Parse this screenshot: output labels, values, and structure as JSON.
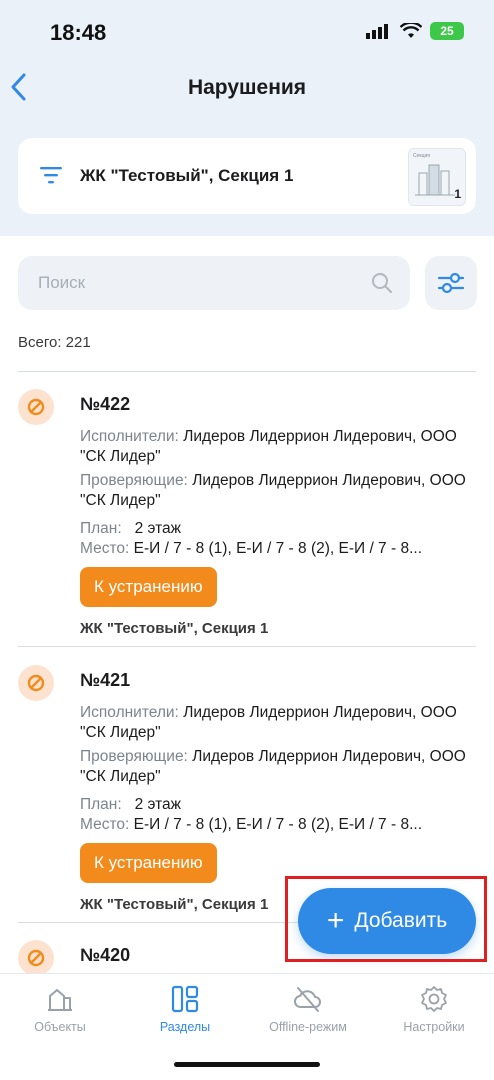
{
  "status_bar": {
    "time": "18:48",
    "battery": "25"
  },
  "nav": {
    "title": "Нарушения"
  },
  "project_selector": {
    "name": "ЖК \"Тестовый\", Секция 1",
    "thumb_label": "Секция",
    "thumb_number": "1"
  },
  "search": {
    "placeholder": "Поиск"
  },
  "total": "Всего: 221",
  "items": [
    {
      "number": "№422",
      "executors_label": "Исполнители:",
      "executors": "Лидеров Лидеррион Лидерович, ООО \"СК Лидер\"",
      "inspectors_label": "Проверяющие:",
      "inspectors": "Лидеров Лидеррион Лидерович, ООО \"СК Лидер\"",
      "plan_label": "План:",
      "plan": "2 этаж",
      "place_label": "Место:",
      "place": "Е-И / 7 - 8 (1), Е-И / 7 - 8 (2), Е-И / 7 - 8...",
      "status": "К устранению",
      "project": "ЖК \"Тестовый\", Секция 1"
    },
    {
      "number": "№421",
      "executors_label": "Исполнители:",
      "executors": "Лидеров Лидеррион Лидерович, ООО \"СК Лидер\"",
      "inspectors_label": "Проверяющие:",
      "inspectors": "Лидеров Лидеррион Лидерович, ООО \"СК Лидер\"",
      "plan_label": "План:",
      "plan": "2 этаж",
      "place_label": "Место:",
      "place": "Е-И / 7 - 8 (1), Е-И / 7 - 8 (2), Е-И / 7 - 8...",
      "status": "К устранению",
      "project": "ЖК \"Тестовый\", Секция 1"
    },
    {
      "number": "№420"
    }
  ],
  "fab": {
    "label": "Добавить"
  },
  "tabs": [
    {
      "label": "Объекты"
    },
    {
      "label": "Разделы",
      "active": true
    },
    {
      "label": "Offline-режим"
    },
    {
      "label": "Настройки"
    }
  ],
  "colors": {
    "accent": "#2f8ae6",
    "status": "#f28b1c",
    "badge_bg": "#fde3cf",
    "highlight": "#e02020"
  }
}
